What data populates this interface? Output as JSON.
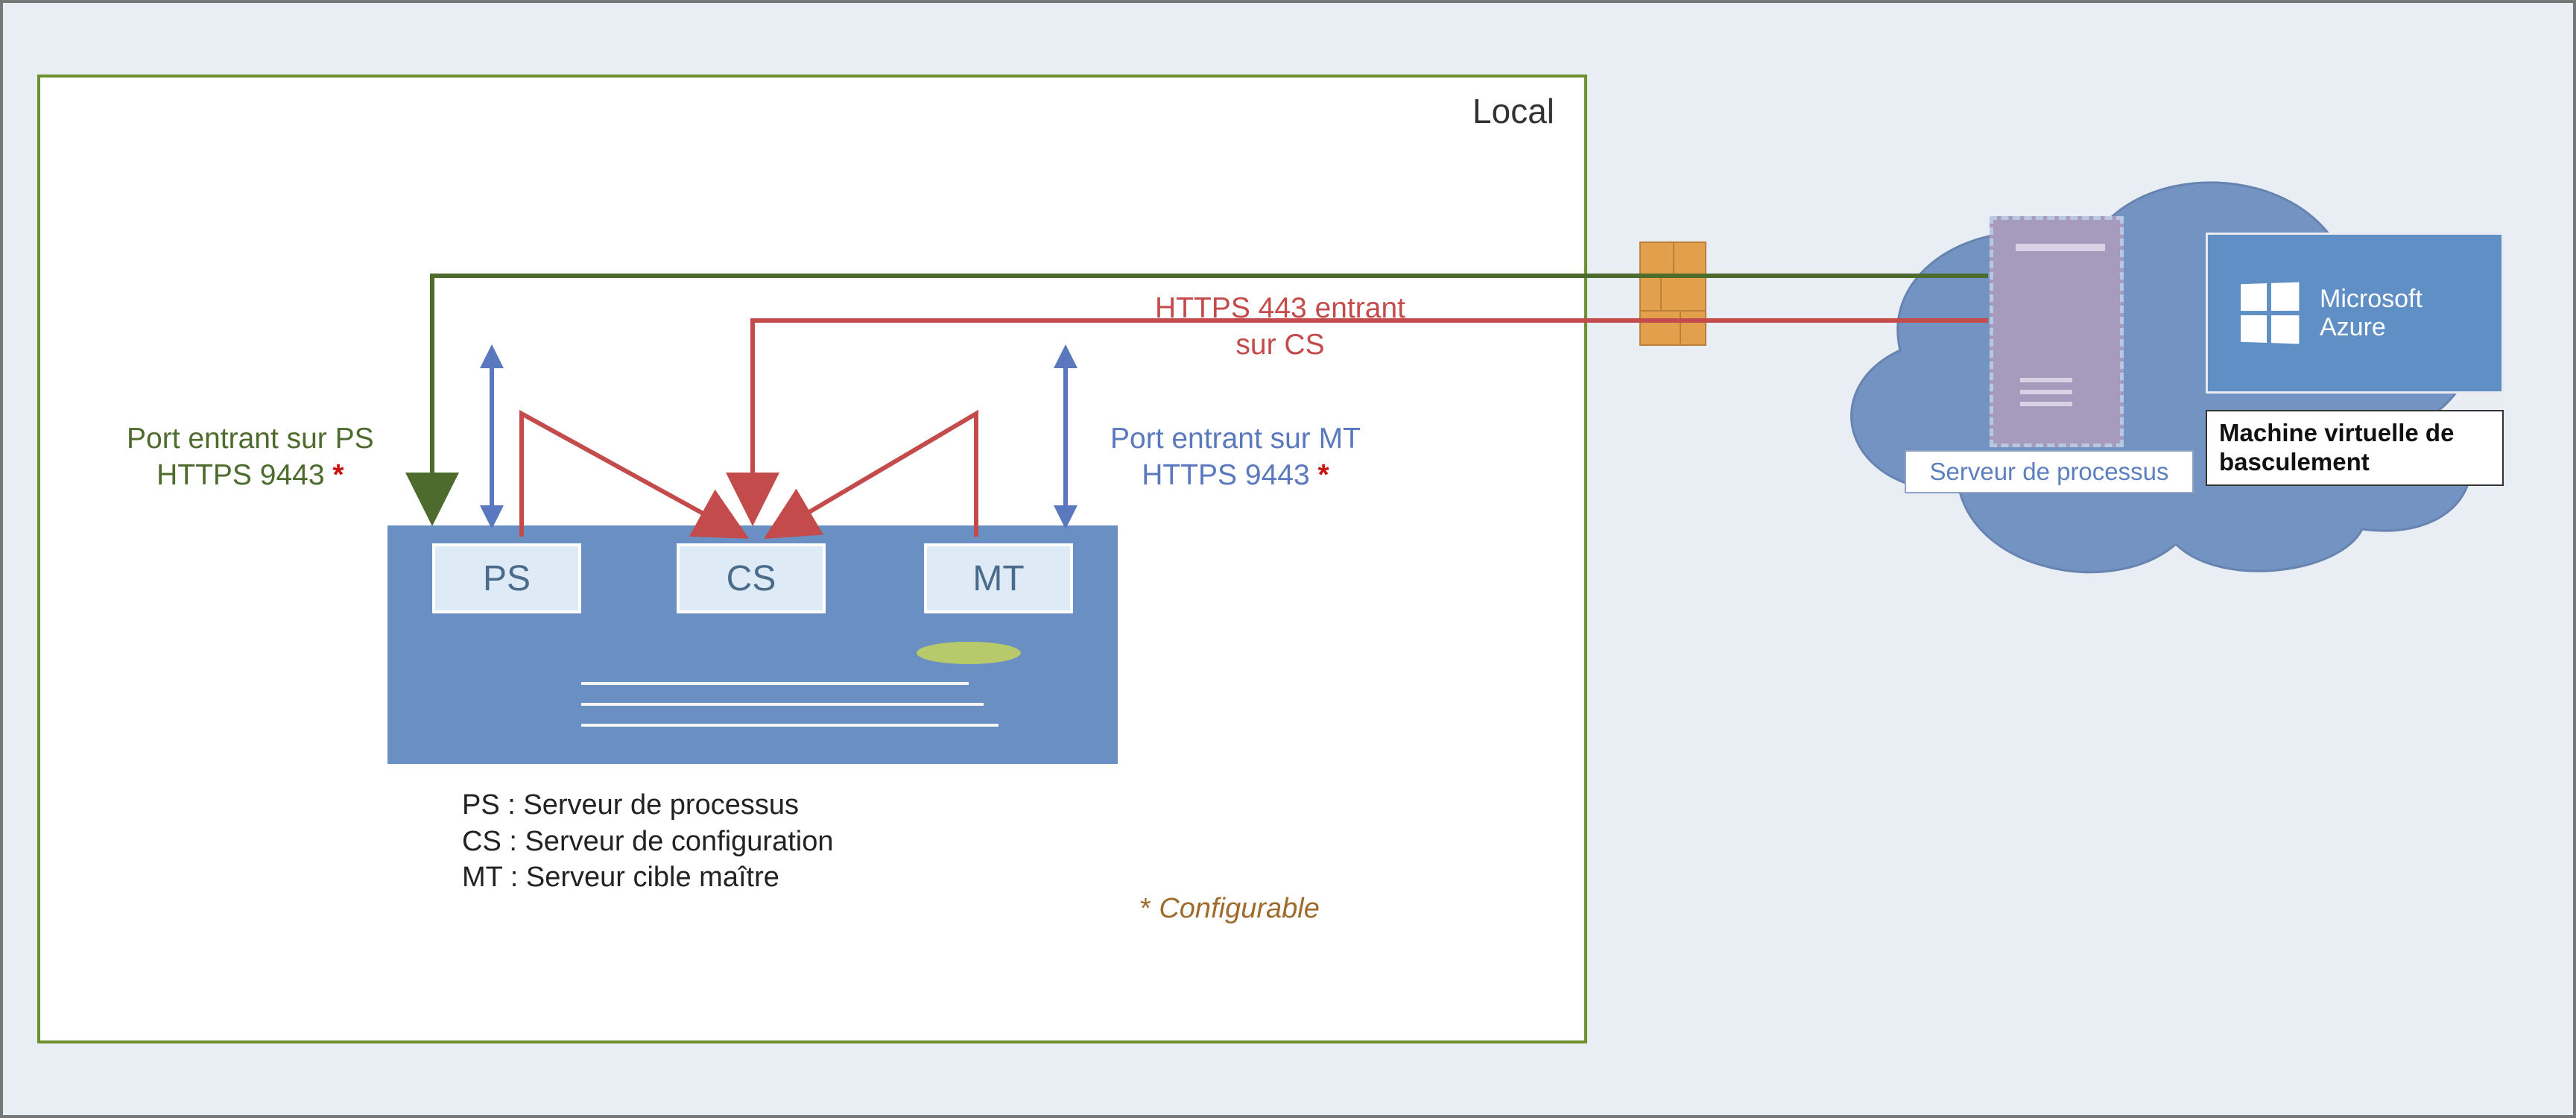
{
  "zones": {
    "local_title": "Local"
  },
  "server_components": {
    "ps": "PS",
    "cs": "CS",
    "mt": "MT"
  },
  "legend": {
    "ps": "PS : Serveur de processus",
    "cs": "CS : Serveur de configuration",
    "mt": "MT : Serveur cible maître"
  },
  "flows": {
    "ps_inbound": {
      "line1": "Port entrant sur PS",
      "line2": "HTTPS 9443",
      "star": "*"
    },
    "mt_inbound": {
      "line1": "Port entrant sur MT",
      "line2": "HTTPS 9443",
      "star": "*"
    },
    "cs_inbound": {
      "line1": "HTTPS 443 entrant",
      "line2": "sur CS"
    }
  },
  "note": {
    "star": "*",
    "text": " Configurable"
  },
  "cloud": {
    "process_server_label": "Serveur de processus",
    "azure_brand1": "Microsoft",
    "azure_brand2": "Azure",
    "vm_label": "Machine virtuelle de basculement"
  }
}
